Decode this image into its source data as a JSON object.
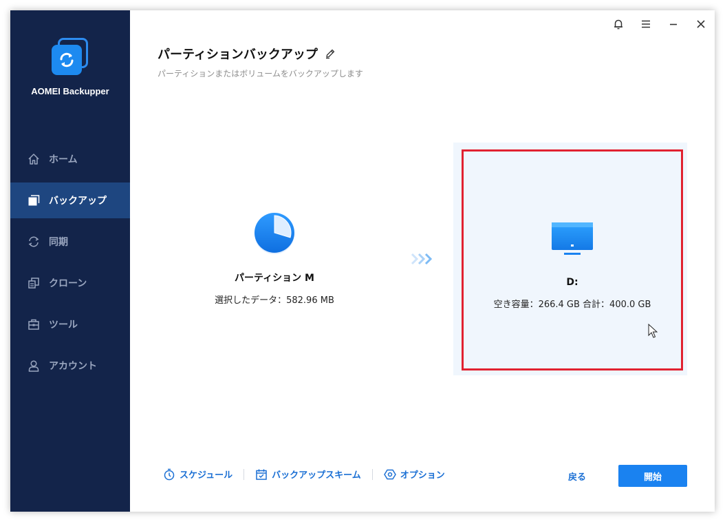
{
  "app": {
    "name": "AOMEI Backupper"
  },
  "sidebar": {
    "items": [
      {
        "label": "ホーム",
        "icon": "home-icon",
        "active": false
      },
      {
        "label": "バックアップ",
        "icon": "backup-icon",
        "active": true
      },
      {
        "label": "同期",
        "icon": "sync-icon",
        "active": false
      },
      {
        "label": "クローン",
        "icon": "clone-icon",
        "active": false
      },
      {
        "label": "ツール",
        "icon": "toolbox-icon",
        "active": false
      },
      {
        "label": "アカウント",
        "icon": "user-icon",
        "active": false
      }
    ]
  },
  "titlebar": {
    "icons": [
      "bell-icon",
      "menu-icon",
      "minimize-icon",
      "close-icon"
    ]
  },
  "page": {
    "title": "パーティションバックアップ",
    "subtitle": "パーティションまたはボリュームをバックアップします"
  },
  "source": {
    "name": "パーティション M",
    "info": "選択したデータ：582.96 MB"
  },
  "target": {
    "name": "D:",
    "info": "空き容量：266.4 GB 合計：400.0 GB"
  },
  "footer": {
    "schedule": "スケジュール",
    "scheme": "バックアップスキーム",
    "options": "オプション",
    "back": "戻る",
    "start": "開始"
  },
  "colors": {
    "sidebar_bg": "#13244a",
    "sidebar_active": "#1e4680",
    "accent": "#1a82f0",
    "highlight_border": "#e12130"
  }
}
